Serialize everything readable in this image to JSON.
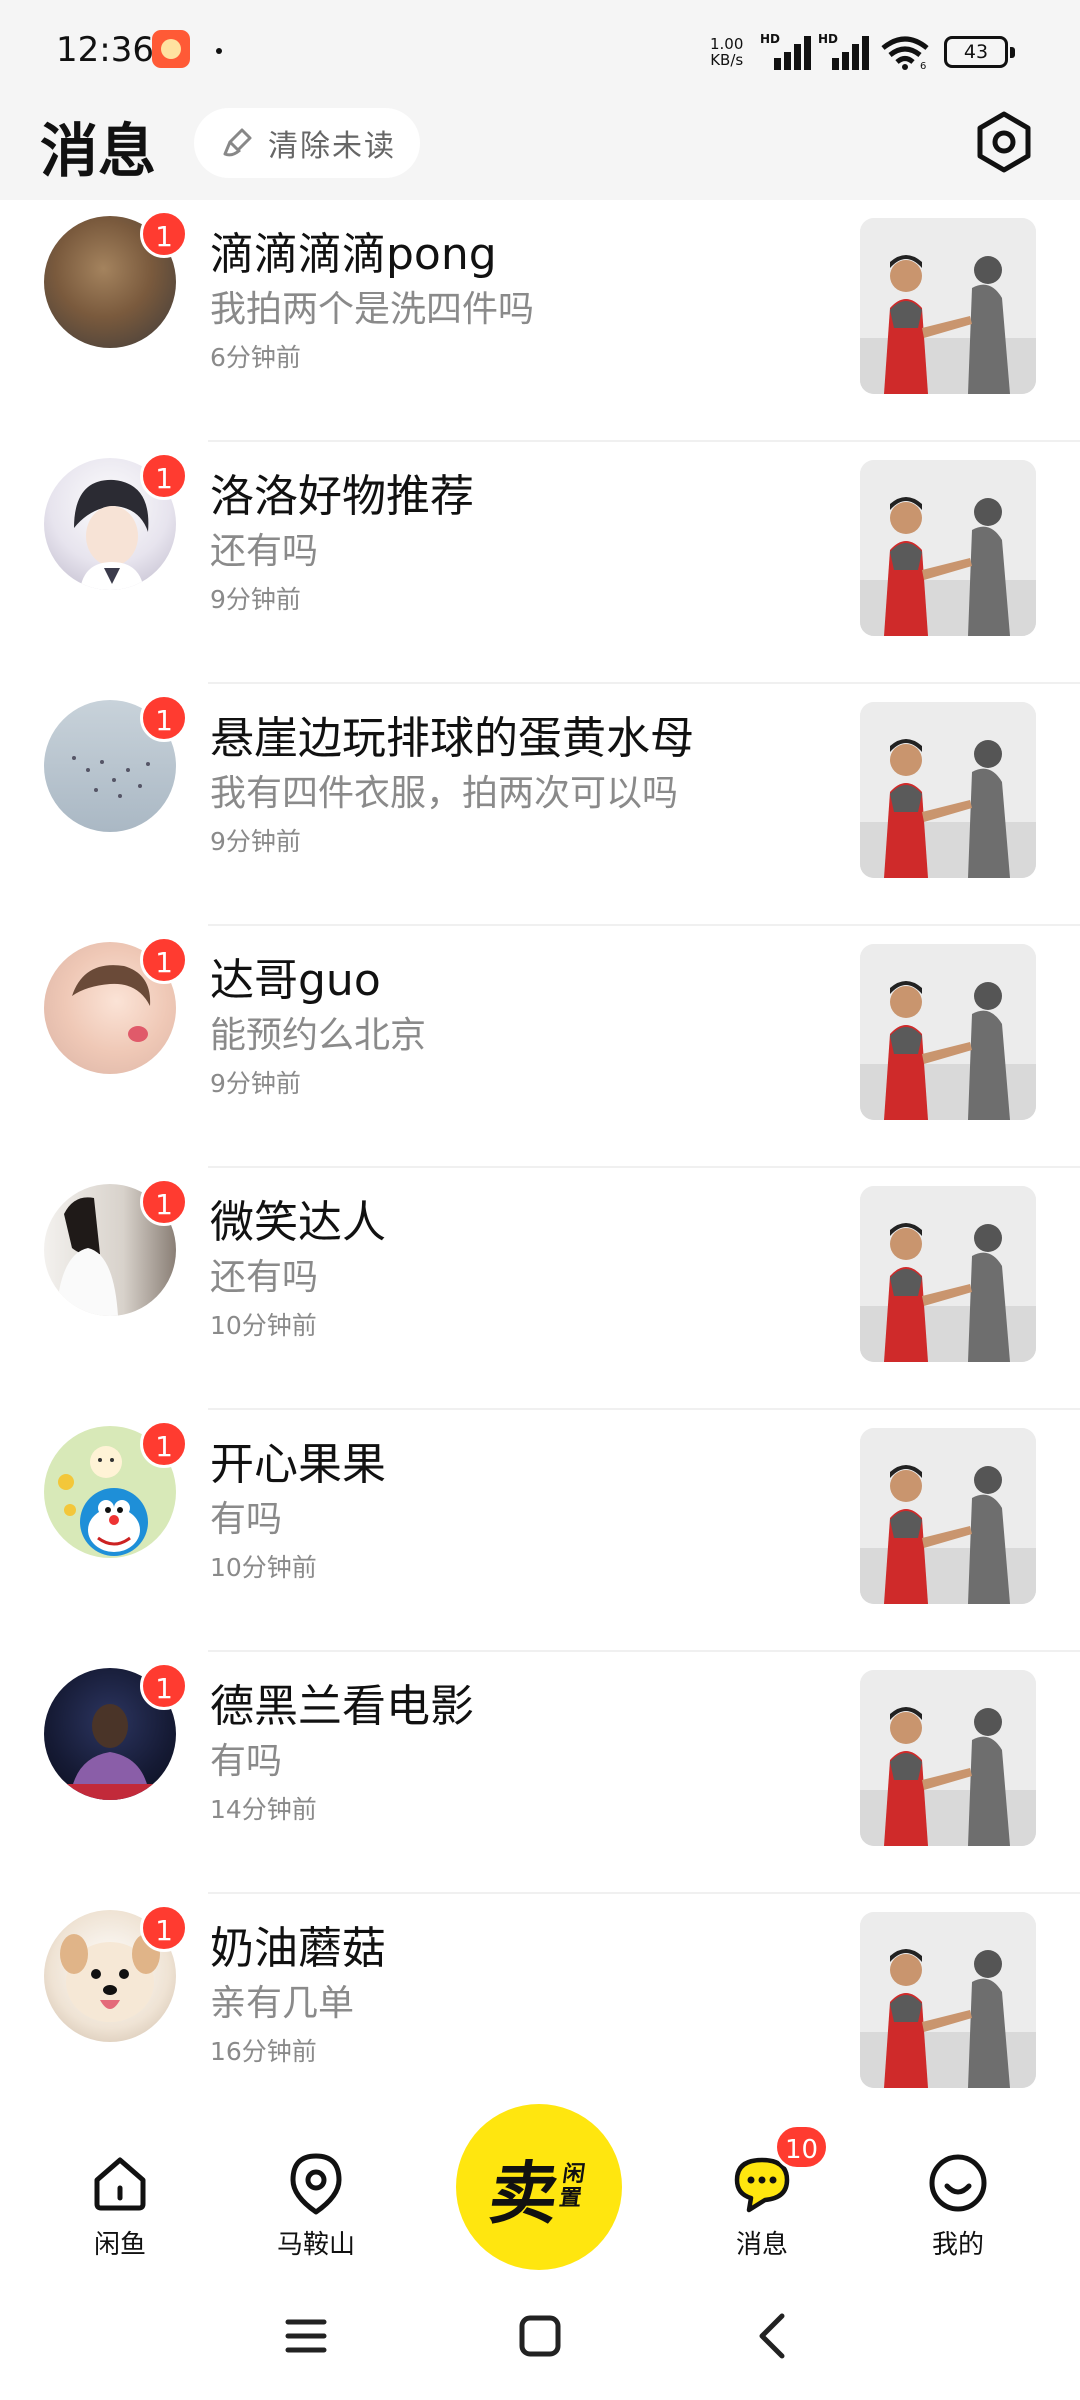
{
  "status_bar": {
    "time": "12:36",
    "net_speed_value": "1.00",
    "net_speed_unit": "KB/s",
    "battery": "43",
    "hd_label": "HD",
    "wifi_sub": "6"
  },
  "header": {
    "title": "消息",
    "clear_unread_label": "清除未读"
  },
  "messages": [
    {
      "name": "滴滴滴滴pong",
      "preview": "我拍两个是洗四件吗",
      "time": "6分钟前",
      "unread": "1",
      "avatar_color": "#8b6a4a"
    },
    {
      "name": "洛洛好物推荐",
      "preview": "还有吗",
      "time": "9分钟前",
      "unread": "1",
      "avatar_color": "#d9d9e6"
    },
    {
      "name": "悬崖边玩排球的蛋黄水母",
      "preview": "我有四件衣服，拍两次可以吗",
      "time": "9分钟前",
      "unread": "1",
      "avatar_color": "#b7c4cf"
    },
    {
      "name": "达哥guo",
      "preview": "能预约么北京",
      "time": "9分钟前",
      "unread": "1",
      "avatar_color": "#f3d2c4"
    },
    {
      "name": "微笑达人",
      "preview": "还有吗",
      "time": "10分钟前",
      "unread": "1",
      "avatar_color": "#c9c2b8"
    },
    {
      "name": "开心果果",
      "preview": "有吗",
      "time": "10分钟前",
      "unread": "1",
      "avatar_color": "#d5e6b5"
    },
    {
      "name": "德黑兰看电影",
      "preview": "有吗",
      "time": "14分钟前",
      "unread": "1",
      "avatar_color": "#1e2238"
    },
    {
      "name": "奶油蘑菇",
      "preview": "亲有几单",
      "time": "16分钟前",
      "unread": "1",
      "avatar_color": "#e8d7c4"
    }
  ],
  "bottom_nav": {
    "home_label": "闲鱼",
    "nearby_label": "马鞍山",
    "sell_main": "卖",
    "sell_sub": "闲置",
    "messages_label": "消息",
    "messages_badge": "10",
    "mine_label": "我的"
  },
  "colors": {
    "accent_yellow": "#ffe60f",
    "badge_red": "#ff3b30",
    "secondary_text": "#8a8a8a",
    "header_bg": "#f5f5f5"
  }
}
